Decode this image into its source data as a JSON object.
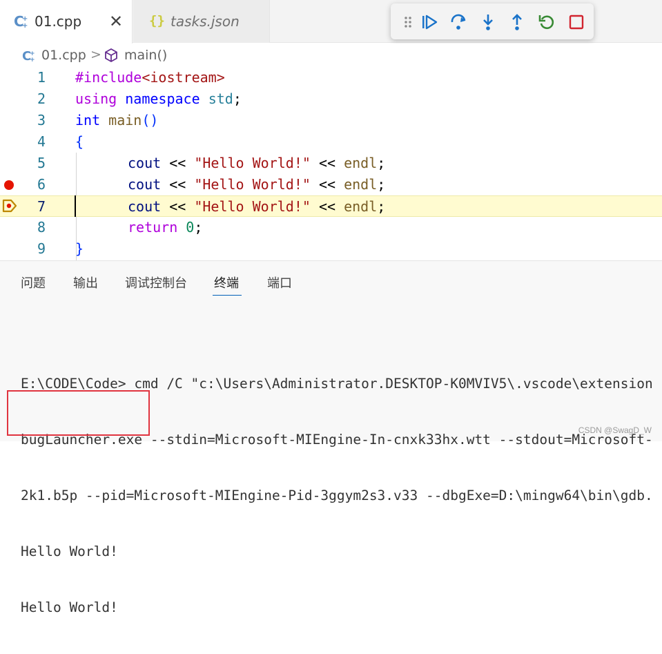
{
  "tabs": [
    {
      "label": "01.cpp",
      "active": true
    },
    {
      "label": "tasks.json",
      "active": false
    }
  ],
  "tab_close_glyph": "✕",
  "json_icon_glyph": "{}",
  "debug_toolbar": {
    "buttons": [
      "drag-handle-icon",
      "continue-icon",
      "step-over-icon",
      "step-into-icon",
      "step-out-icon",
      "restart-icon",
      "stop-icon"
    ],
    "colors": {
      "blue": "#1a73c9",
      "green": "#388a34",
      "red": "#d1242f"
    }
  },
  "breadcrumb": {
    "file": "01.cpp",
    "separator": ">",
    "symbol": "main()"
  },
  "editor": {
    "current_line": 7,
    "breakpoints": [
      6
    ],
    "lines": [
      {
        "n": "1"
      },
      {
        "n": "2"
      },
      {
        "n": "3"
      },
      {
        "n": "4"
      },
      {
        "n": "5"
      },
      {
        "n": "6"
      },
      {
        "n": "7"
      },
      {
        "n": "8"
      },
      {
        "n": "9"
      }
    ],
    "code": {
      "l1_a": "#include",
      "l1_b": "<iostream>",
      "l2_a": "using",
      "l2_b": "namespace",
      "l2_c": "std",
      "l2_d": ";",
      "l3_a": "int",
      "l3_b": "main",
      "l3_c": "()",
      "l4": "{",
      "l5_a": "cout",
      "l5_b": " << ",
      "l5_c": "\"Hello World!\"",
      "l5_d": " << ",
      "l5_e": "endl",
      "l5_f": ";",
      "l6_a": "cout",
      "l6_b": " << ",
      "l6_c": "\"Hello World!\"",
      "l6_d": " << ",
      "l6_e": "endl",
      "l6_f": ";",
      "l7_a": "cout",
      "l7_b": " << ",
      "l7_c": "\"Hello World!\"",
      "l7_d": " << ",
      "l7_e": "endl",
      "l7_f": ";",
      "l8_a": "return",
      "l8_b": "0",
      "l8_c": ";",
      "l9": "}"
    }
  },
  "panel": {
    "tabs": [
      "问题",
      "输出",
      "调试控制台",
      "终端",
      "端口"
    ],
    "active_tab": "终端"
  },
  "terminal": {
    "lines": [
      "E:\\CODE\\Code> cmd /C \"c:\\Users\\Administrator.DESKTOP-K0MVIV5\\.vscode\\extension",
      "bugLauncher.exe --stdin=Microsoft-MIEngine-In-cnxk33hx.wtt --stdout=Microsoft-",
      "2k1.b5p --pid=Microsoft-MIEngine-Pid-3ggym2s3.v33 --dbgExe=D:\\mingw64\\bin\\gdb.",
      "Hello World!",
      "Hello World!"
    ],
    "highlight_color": "#e0343f"
  },
  "watermark": "CSDN @SwagD_W"
}
